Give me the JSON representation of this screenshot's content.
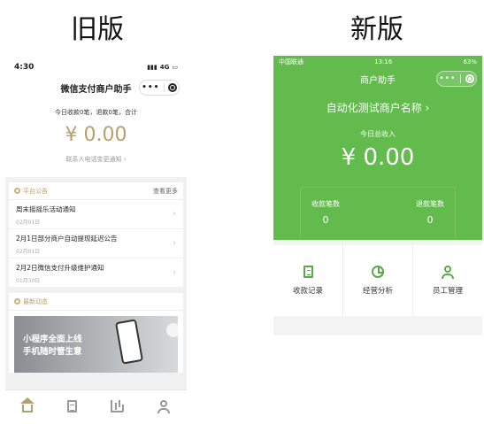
{
  "headings": {
    "old": "旧版",
    "new": "新版"
  },
  "old": {
    "status": {
      "time": "4:30",
      "network": "4G"
    },
    "nav": {
      "title": "微信支付商户助手",
      "more_icon": "more-dots-icon",
      "close_icon": "target-icon"
    },
    "summary": {
      "line": "今日收款0笔，退款0笔，合计",
      "amount": "¥ 0.00",
      "notice": "联系人电话变更通知 ›"
    },
    "announcements": {
      "title": "平台公告",
      "more": "查看更多",
      "items": [
        {
          "title": "周末摇摇乐活动通知",
          "date": "02月01日"
        },
        {
          "title": "2月1日部分商户自动提现延迟公告",
          "date": "02月01日"
        },
        {
          "title": "2月2日微信支付升级维护通知",
          "date": "01月30日"
        }
      ]
    },
    "news": {
      "title": "最新动态",
      "banner_line1": "小程序全面上线",
      "banner_line2": "手机随时管生意"
    },
    "tabbar": [
      "home-icon",
      "orders-icon",
      "chart-icon",
      "profile-icon"
    ]
  },
  "new": {
    "status": {
      "carrier": "中国联通",
      "time": "13:16",
      "battery": "63%"
    },
    "nav": {
      "title": "商户助手"
    },
    "merchant_name": "自动化测试商户名称 ›",
    "today_label": "今日总收入",
    "today_amount": "¥ 0.00",
    "stats": [
      {
        "label": "收款笔数",
        "value": "0"
      },
      {
        "label": "退款笔数",
        "value": "0"
      }
    ],
    "menu": [
      {
        "label": "收款记录",
        "icon": "receipt-icon"
      },
      {
        "label": "经营分析",
        "icon": "pie-chart-icon"
      },
      {
        "label": "员工管理",
        "icon": "staff-icon"
      }
    ],
    "accent_color": "#63bb4e"
  }
}
